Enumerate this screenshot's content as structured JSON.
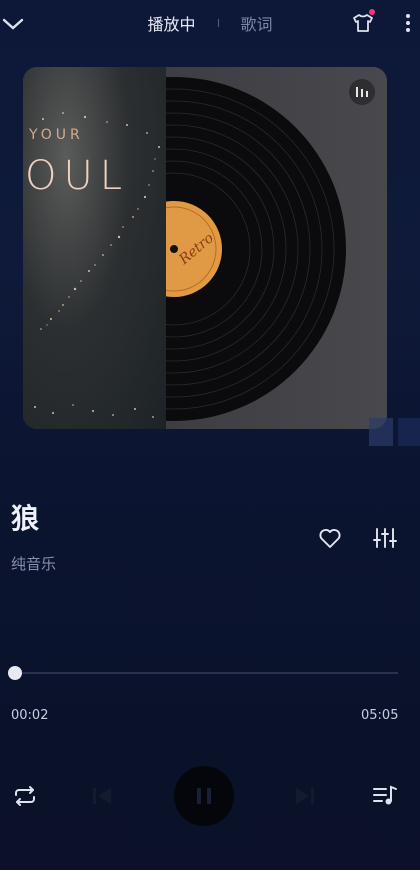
{
  "header": {
    "tabs": [
      {
        "label": "播放中",
        "active": true
      },
      {
        "label": "歌词",
        "active": false
      }
    ],
    "icons": [
      "chevron-down-icon",
      "shirt-icon",
      "more-vertical-icon"
    ],
    "notification_dot_color": "#ff2f7a"
  },
  "album_art": {
    "cover_text_line1": "YOUR",
    "cover_text_line2": "OUL",
    "record_label": "Retro",
    "overlay_icon": "bars-icon"
  },
  "song": {
    "title": "狼",
    "artist": "纯音乐"
  },
  "progress": {
    "current": "00:02",
    "total": "05:05",
    "fraction": 0.007
  },
  "controls": {
    "icons": [
      "repeat-icon",
      "previous-icon",
      "pause-icon",
      "next-icon",
      "playlist-icon"
    ],
    "state": "playing"
  },
  "colors": {
    "background": "#0d1838",
    "active_text": "#e7eaf4",
    "muted_text": "#7c86a6",
    "record_label": "#e09a45"
  }
}
